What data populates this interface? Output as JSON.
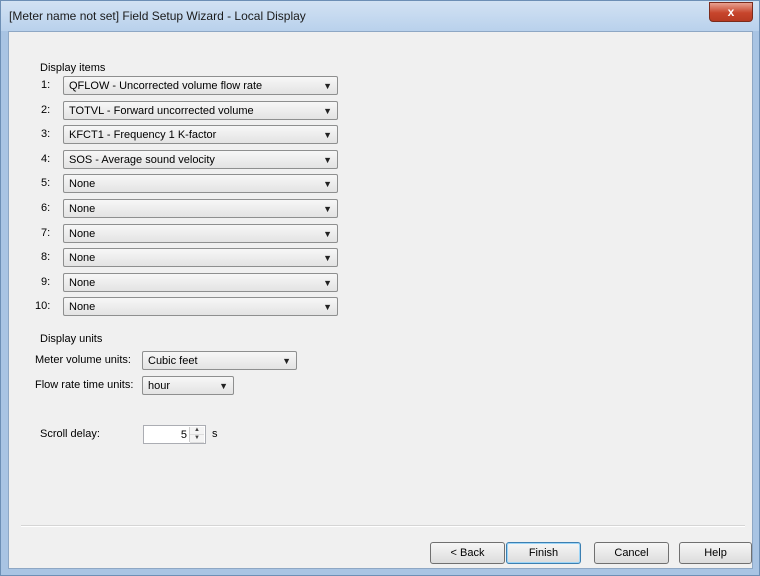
{
  "window": {
    "title": "[Meter name not set] Field Setup Wizard - Local Display",
    "close_glyph": "x"
  },
  "display_items": {
    "label": "Display items",
    "rows": [
      {
        "num": "1:",
        "value": "QFLOW - Uncorrected volume flow rate"
      },
      {
        "num": "2:",
        "value": "TOTVL - Forward uncorrected volume"
      },
      {
        "num": "3:",
        "value": "KFCT1 - Frequency 1 K-factor"
      },
      {
        "num": "4:",
        "value": "SOS - Average sound velocity"
      },
      {
        "num": "5:",
        "value": "None"
      },
      {
        "num": "6:",
        "value": "None"
      },
      {
        "num": "7:",
        "value": "None"
      },
      {
        "num": "8:",
        "value": "None"
      },
      {
        "num": "9:",
        "value": "None"
      },
      {
        "num": "10:",
        "value": "None"
      }
    ]
  },
  "display_units": {
    "label": "Display units",
    "volume_label": "Meter volume units:",
    "volume_value": "Cubic feet",
    "time_label": "Flow rate time units:",
    "time_value": "hour"
  },
  "scroll": {
    "label": "Scroll delay:",
    "value": "5",
    "unit": "s"
  },
  "buttons": {
    "back": "< Back",
    "finish": "Finish",
    "cancel": "Cancel",
    "help": "Help"
  },
  "icons": {
    "dropdown": "chevron-down-icon",
    "spin_up": "spin-up-icon",
    "spin_down": "spin-down-icon",
    "close": "close-icon"
  }
}
